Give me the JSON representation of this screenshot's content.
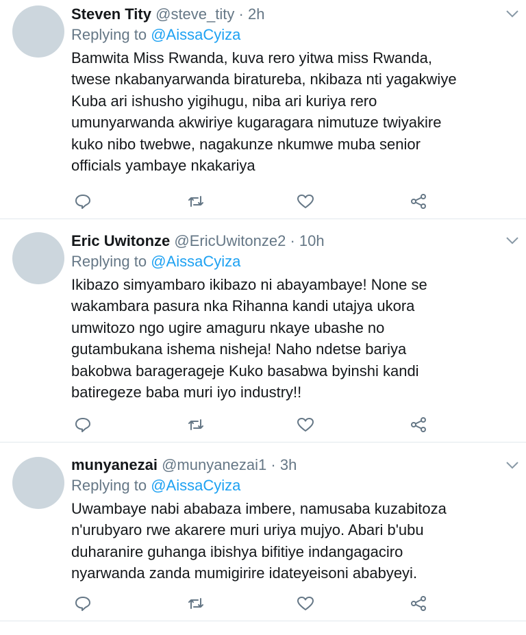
{
  "tweets": [
    {
      "name": "Steven Tity",
      "handle": "@steve_tity",
      "sep": "·",
      "time": "2h",
      "replying_prefix": "Replying to",
      "replying_to": "@AissaCyiza",
      "body_lines": [
        "Bamwita Miss Rwanda, kuva rero yitwa miss Rwanda,",
        "twese nkabanyarwanda biratureba, nkibaza nti yagakwiye",
        "Kuba ari ishusho yigihugu, niba ari kuriya rero",
        "umunyarwanda akwiriye kugaragara nimutuze twiyakire",
        "kuko nibo twebwe, nagakunze nkumwe muba senior",
        "officials yambaye nkakariya"
      ]
    },
    {
      "name": "Eric Uwitonze",
      "handle": "@EricUwitonze2",
      "sep": "·",
      "time": "10h",
      "replying_prefix": "Replying to",
      "replying_to": "@AissaCyiza",
      "body_lines": [
        "Ikibazo simyambaro ikibazo ni abayambaye! None se",
        "wakambara pasura nka Rihanna kandi utajya ukora",
        "umwitozo ngo ugire amaguru nkaye ubashe no",
        "gutambukana ishema nisheja! Naho ndetse bariya",
        "bakobwa barageragej̈e Kuko basabwa byinshi kandi",
        "batiregeze baba muri iyo industry!!"
      ]
    },
    {
      "name": "munyanezai",
      "handle": "@munyanezai1",
      "sep": "·",
      "time": "3h",
      "replying_prefix": "Replying to",
      "replying_to": "@AissaCyiza",
      "body_lines": [
        "Uwambaye nabi ababaza imbere, namusaba kuzabitoza",
        "n'urubyaro rwe  akarere muri uriya mujyo. Abari b'ubu",
        "duharanire guhanga ibishya bifitiye indangagaciro",
        "nyarwanda zanda mumigirire idateyeisoni ababyeyi."
      ]
    }
  ],
  "icons": {
    "avatar": "default-avatar",
    "menu": "chevron-down-icon",
    "reply": "reply-icon",
    "retweet": "retweet-icon",
    "like": "heart-icon",
    "share": "share-icon"
  },
  "colors": {
    "text": "#14171a",
    "muted": "#657786",
    "link": "#1da1f2",
    "avatar": "#ccd6dd",
    "divider": "#e1e8ed"
  }
}
